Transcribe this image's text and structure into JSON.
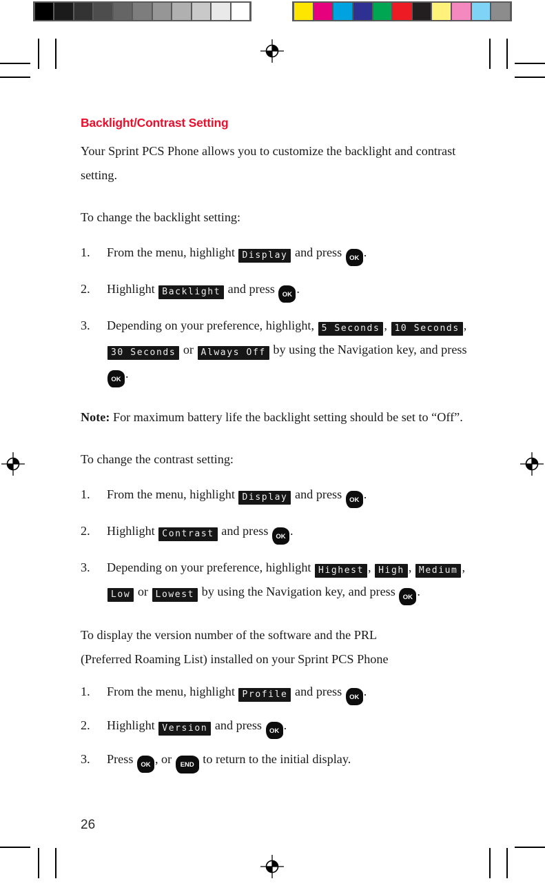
{
  "document": {
    "page_number": "26",
    "heading": "Backlight/Contrast Setting",
    "intro": "Your Sprint PCS Phone allows you to customize the backlight and contrast setting.",
    "backlight_lead": "To change the backlight setting:",
    "contrast_lead": "To change the contrast setting:",
    "note_label": "Note:",
    "note_text": "For maximum battery life the backlight setting should be set to “Off”.",
    "version_lead_line1": "To display the version number of the software and the PRL",
    "version_lead_line2": "(Preferred Roaming List) installed on your Sprint PCS Phone"
  },
  "keys": {
    "ok": "OK",
    "end": "END"
  },
  "menu_labels": {
    "display": "Display",
    "backlight": "Backlight",
    "contrast": "Contrast",
    "profile": "Profile",
    "version": "Version",
    "seconds_5": "5 Seconds",
    "seconds_10": "10 Seconds",
    "seconds_30": "30 Seconds",
    "always_off": "Always Off",
    "highest": "Highest",
    "high": "High",
    "medium": "Medium",
    "low": "Low",
    "lowest": "Lowest"
  },
  "backlight_steps": {
    "n1": "1.",
    "n2": "2.",
    "n3": "3.",
    "s1_a": "From  the menu, highlight",
    "s1_b": "and press",
    "s1_c": ".",
    "s2_a": "Highlight",
    "s2_b": "and press",
    "s2_c": ".",
    "s3_a": "Depending on your preference, highlight,",
    "s3_comma": ",",
    "s3_or": "or",
    "s3_b": "by using the",
    "s3_c": "Navigation key, and press",
    "s3_d": "."
  },
  "contrast_steps": {
    "n1": "1.",
    "n2": "2.",
    "n3": "3.",
    "s1_a": "From  the menu, highlight",
    "s1_b": "and press",
    "s1_c": ".",
    "s2_a": "Highlight",
    "s2_b": "and press",
    "s2_c": ".",
    "s3_a": "Depending on your preference, highlight",
    "s3_comma": ",",
    "s3_or": "or",
    "s3_b": "by using the Navigation key, and press",
    "s3_c": "."
  },
  "version_steps": {
    "n1": "1.",
    "n2": "2.",
    "n3": "3.",
    "s1_a": "From the menu, highlight",
    "s1_b": "and press",
    "s1_c": ".",
    "s2_a": "Highlight",
    "s2_b": "and press",
    "s2_c": ".",
    "s3_a": "Press",
    "s3_comma": ",",
    "s3_or": "or",
    "s3_b": "to return to the initial display."
  },
  "calibration": {
    "grayscale_patches": [
      "#000000",
      "#1b1b1b",
      "#333333",
      "#4d4d4d",
      "#656565",
      "#7d7d7d",
      "#969696",
      "#b0b0b0",
      "#c9c9c9",
      "#e9e9e9",
      "#ffffff"
    ],
    "color_patches": [
      "#ffe600",
      "#e6007e",
      "#00a3e0",
      "#2e3192",
      "#00a651",
      "#ed1c24",
      "#231f20",
      "#fff27a",
      "#f489c0",
      "#7fd4f5",
      "#8c8c8c"
    ]
  }
}
